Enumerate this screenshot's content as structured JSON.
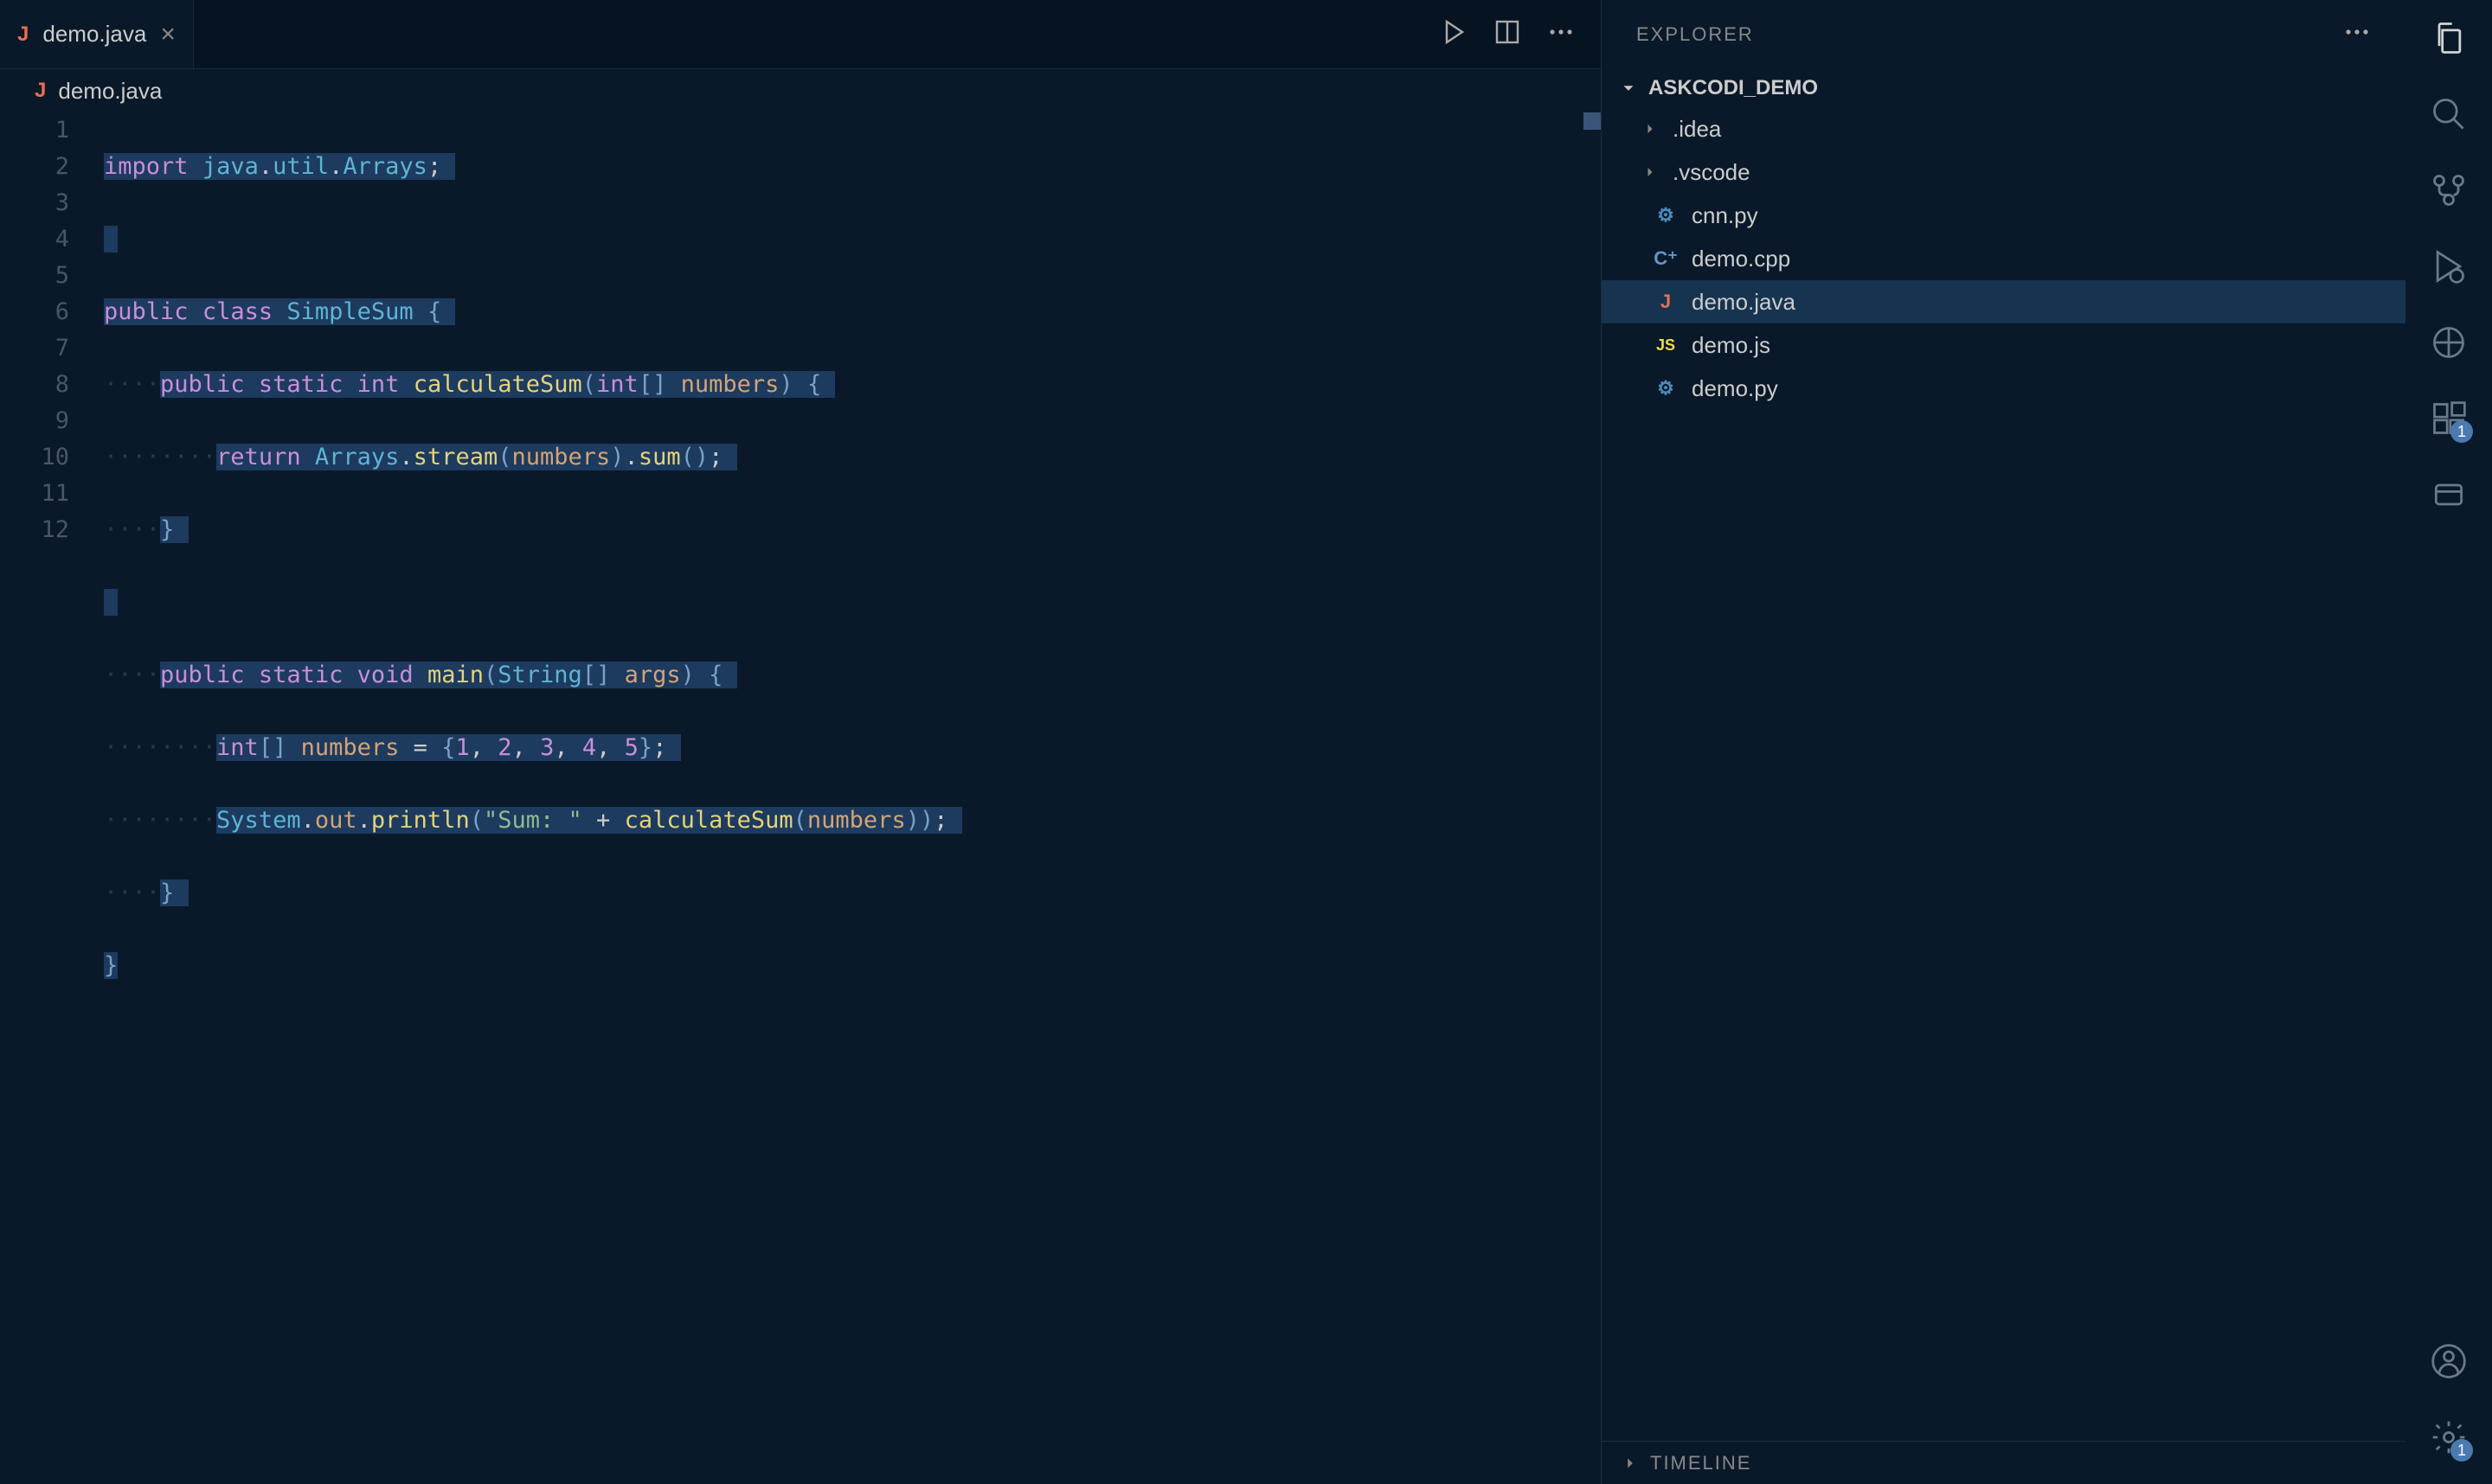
{
  "tab": {
    "filename": "demo.java",
    "icon": "J"
  },
  "breadcrumb": {
    "filename": "demo.java",
    "icon": "J"
  },
  "editor": {
    "lineNumbers": [
      "1",
      "2",
      "3",
      "4",
      "5",
      "6",
      "7",
      "8",
      "9",
      "10",
      "11",
      "12"
    ],
    "code": {
      "l1": {
        "kw_import": "import",
        "pkg": "java",
        "d1": ".",
        "util": "util",
        "d2": ".",
        "arrays": "Arrays",
        "semi": ";"
      },
      "l3": {
        "kw_public": "public",
        "kw_class": "class",
        "cls": "SimpleSum",
        "brace": "{"
      },
      "l4": {
        "kw_public": "public",
        "kw_static": "static",
        "type": "int",
        "fn": "calculateSum",
        "p1": "(",
        "type2": "int",
        "arr": "[]",
        "arg": "numbers",
        "p2": ")",
        "brace": "{"
      },
      "l5": {
        "kw_return": "return",
        "cls": "Arrays",
        "d": ".",
        "fn": "stream",
        "p1": "(",
        "arg": "numbers",
        "p2": ")",
        "d2": ".",
        "fn2": "sum",
        "p3": "()",
        "semi": ";"
      },
      "l6": {
        "brace": "}"
      },
      "l8": {
        "kw_public": "public",
        "kw_static": "static",
        "kw_void": "void",
        "fn": "main",
        "p1": "(",
        "cls": "String",
        "arr": "[]",
        "arg": "args",
        "p2": ")",
        "brace": "{"
      },
      "l9": {
        "type": "int",
        "arr": "[]",
        "var": "numbers",
        "eq": "=",
        "brace": "{",
        "n1": "1",
        "c1": ",",
        "n2": "2",
        "c2": ",",
        "n3": "3",
        "c3": ",",
        "n4": "4",
        "c4": ",",
        "n5": "5",
        "brace2": "}",
        "semi": ";"
      },
      "l10": {
        "cls": "System",
        "d": ".",
        "out": "out",
        "d2": ".",
        "fn": "println",
        "p1": "(",
        "str": "\"Sum: \"",
        "plus": "+",
        "fn2": "calculateSum",
        "p2": "(",
        "arg": "numbers",
        "p3": ")",
        ")": ")",
        "semi": ";"
      },
      "l11": {
        "brace": "}"
      },
      "l12": {
        "brace": "}"
      }
    }
  },
  "explorer": {
    "title": "EXPLORER",
    "workspace": "ASKCODI_DEMO",
    "items": [
      {
        "type": "folder",
        "name": ".idea"
      },
      {
        "type": "folder",
        "name": ".vscode"
      },
      {
        "type": "file",
        "name": "cnn.py",
        "icon": "py"
      },
      {
        "type": "file",
        "name": "demo.cpp",
        "icon": "cpp"
      },
      {
        "type": "file",
        "name": "demo.java",
        "icon": "java",
        "selected": true
      },
      {
        "type": "file",
        "name": "demo.js",
        "icon": "js"
      },
      {
        "type": "file",
        "name": "demo.py",
        "icon": "py"
      }
    ],
    "timeline": "TIMELINE"
  },
  "activity": {
    "ext_badge": "1",
    "settings_badge": "1"
  }
}
